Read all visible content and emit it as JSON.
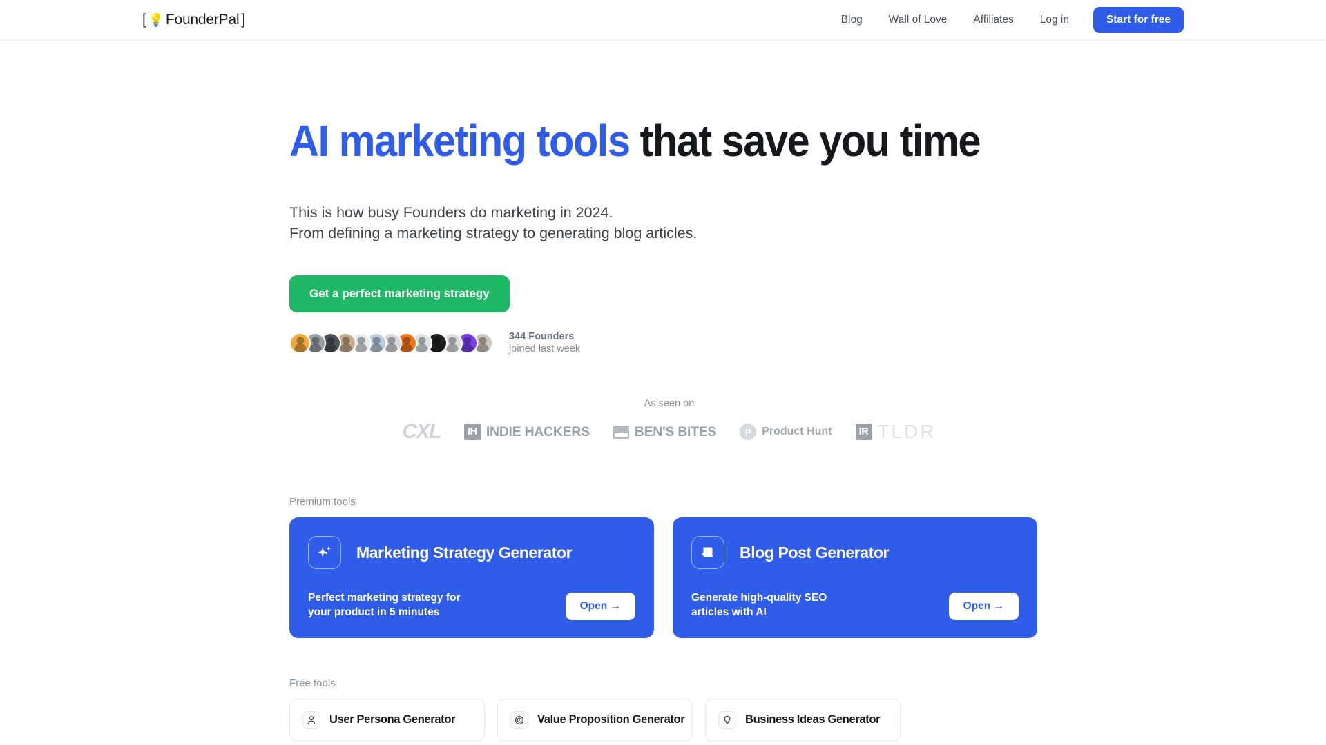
{
  "brand": {
    "bracket_open": "[",
    "bulb_icon": "lightbulb-icon",
    "name": "FounderPal",
    "bracket_close": "]"
  },
  "nav": {
    "links": [
      {
        "label": "Blog"
      },
      {
        "label": "Wall of Love"
      },
      {
        "label": "Affiliates"
      },
      {
        "label": "Log in"
      }
    ],
    "cta_label": "Start for free"
  },
  "hero": {
    "headline_highlight": "AI marketing tools",
    "headline_rest": " that save you time",
    "subtitle_line1": "This is how busy Founders do marketing in 2024.",
    "subtitle_line2": "From defining a marketing strategy to generating blog articles.",
    "cta_label": "Get a perfect marketing strategy",
    "social_count": "344 Founders",
    "social_sub": "joined last week",
    "avatar_colors": [
      "#f0a93c",
      "#9aa0a8",
      "#4e5358",
      "#c9a98c",
      "#e8e9ea",
      "#b9cfe0",
      "#d8dade",
      "#f4761c",
      "#dfe3e6",
      "#201f22",
      "#dcdfe3",
      "#7b3ff0",
      "#cfc6bb"
    ]
  },
  "as_seen_on": {
    "label": "As seen on",
    "logos": [
      {
        "name": "CXL",
        "kind": "cxl"
      },
      {
        "name": "IH",
        "kind": "indie-hackers",
        "text": "INDIE HACKERS"
      },
      {
        "name": "BEN'S BITES",
        "kind": "bens-bites",
        "text": "BEN'S BITES"
      },
      {
        "name": "P",
        "kind": "product-hunt",
        "text": "Product Hunt"
      },
      {
        "name": "IR",
        "kind": "tldr",
        "text": "TLDR"
      }
    ]
  },
  "premium": {
    "section_label": "Premium tools",
    "cards": [
      {
        "icon": "sparkle-icon",
        "title": "Marketing Strategy Generator",
        "desc_line1": "Perfect marketing strategy for",
        "desc_line2": "your product in 5 minutes",
        "open_label": "Open →"
      },
      {
        "icon": "scroll-icon",
        "title": "Blog Post Generator",
        "desc_line1": "Generate high-quality SEO",
        "desc_line2": "articles with AI",
        "open_label": "Open →"
      }
    ]
  },
  "free": {
    "section_label": "Free tools",
    "cards": [
      {
        "icon": "person-icon",
        "title": "User Persona Generator"
      },
      {
        "icon": "target-icon",
        "title": "Value Proposition Generator"
      },
      {
        "icon": "lightbulb-icon",
        "title": "Business Ideas Generator"
      }
    ]
  },
  "colors": {
    "brand_blue": "#2f5ce8",
    "cta_green": "#1fb866",
    "text_dark": "#15181c",
    "text_muted": "#868d97"
  }
}
